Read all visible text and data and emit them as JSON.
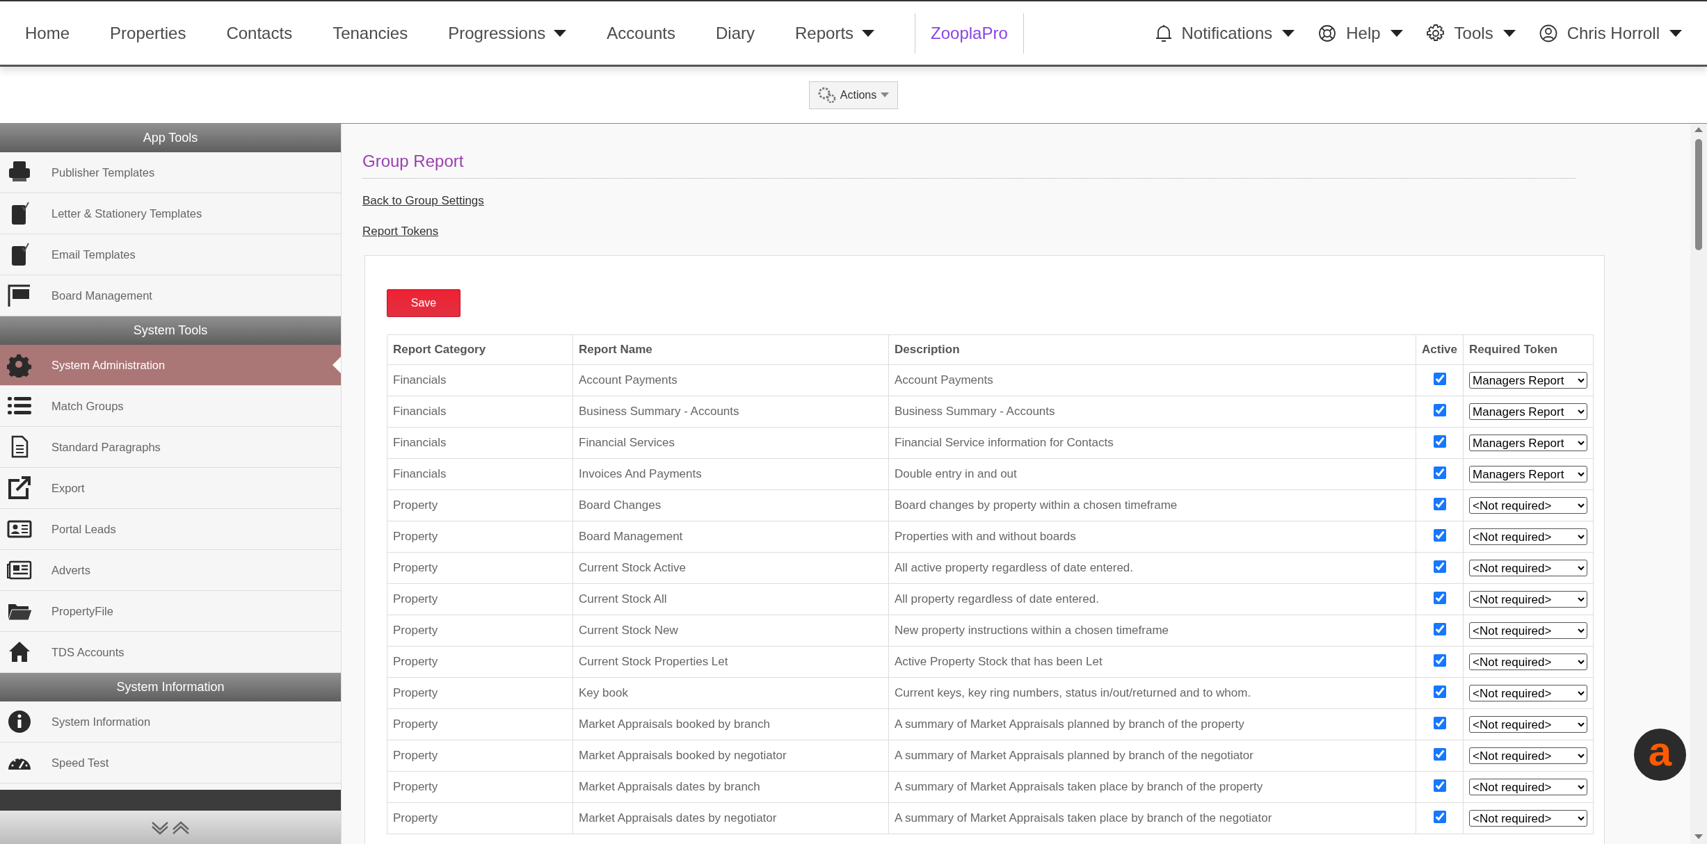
{
  "nav": {
    "items": [
      {
        "label": "Home",
        "dropdown": false,
        "kind": "link"
      },
      {
        "label": "Properties",
        "dropdown": false,
        "kind": "link"
      },
      {
        "label": "Contacts",
        "dropdown": false,
        "kind": "link"
      },
      {
        "label": "Tenancies",
        "dropdown": false,
        "kind": "link"
      },
      {
        "label": "Progressions",
        "dropdown": true,
        "kind": "link"
      },
      {
        "label": "Accounts",
        "dropdown": false,
        "kind": "link"
      },
      {
        "label": "Diary",
        "dropdown": false,
        "kind": "link"
      },
      {
        "label": "Reports",
        "dropdown": true,
        "kind": "link"
      },
      {
        "label": "ZooplaPro",
        "dropdown": false,
        "kind": "brand"
      }
    ],
    "right": [
      {
        "label": "Notifications",
        "dropdown": true
      },
      {
        "label": "Help",
        "dropdown": true
      },
      {
        "label": "Tools",
        "dropdown": true
      },
      {
        "label": "Chris Horroll",
        "dropdown": true
      }
    ]
  },
  "actions_button": "Actions",
  "sidebar": {
    "sections": [
      {
        "title": "App Tools",
        "items": [
          {
            "label": "Publisher Templates",
            "selected": false
          },
          {
            "label": "Letter & Stationery Templates",
            "selected": false
          },
          {
            "label": "Email Templates",
            "selected": false
          },
          {
            "label": "Board Management",
            "selected": false
          }
        ]
      },
      {
        "title": "System Tools",
        "items": [
          {
            "label": "System Administration",
            "selected": true
          },
          {
            "label": "Match Groups",
            "selected": false
          },
          {
            "label": "Standard Paragraphs",
            "selected": false
          },
          {
            "label": "Export",
            "selected": false
          },
          {
            "label": "Portal Leads",
            "selected": false
          },
          {
            "label": "Adverts",
            "selected": false
          },
          {
            "label": "PropertyFile",
            "selected": false
          },
          {
            "label": "TDS Accounts",
            "selected": false
          }
        ]
      },
      {
        "title": "System Information",
        "items": [
          {
            "label": "System Information",
            "selected": false
          },
          {
            "label": "Speed Test",
            "selected": false
          }
        ]
      }
    ]
  },
  "page": {
    "title": "Group Report",
    "links": [
      "Back to Group Settings",
      "Report Tokens"
    ],
    "save_button": "Save",
    "table": {
      "columns": [
        "Report Category",
        "Report Name",
        "Description",
        "Active",
        "Required Token"
      ],
      "rows": [
        {
          "category": "Financials",
          "name": "Account Payments",
          "description": "Account Payments",
          "active": true,
          "token": "Managers Report"
        },
        {
          "category": "Financials",
          "name": "Business Summary - Accounts",
          "description": "Business Summary - Accounts",
          "active": true,
          "token": "Managers Report"
        },
        {
          "category": "Financials",
          "name": "Financial Services",
          "description": "Financial Service information for Contacts",
          "active": true,
          "token": "Managers Report"
        },
        {
          "category": "Financials",
          "name": "Invoices And Payments",
          "description": "Double entry in and out",
          "active": true,
          "token": "Managers Report"
        },
        {
          "category": "Property",
          "name": "Board Changes",
          "description": "Board changes by property within a chosen timeframe",
          "active": true,
          "token": "<Not required>"
        },
        {
          "category": "Property",
          "name": "Board Management",
          "description": "Properties with and without boards",
          "active": true,
          "token": "<Not required>"
        },
        {
          "category": "Property",
          "name": "Current Stock Active",
          "description": "All active property regardless of date entered.",
          "active": true,
          "token": "<Not required>"
        },
        {
          "category": "Property",
          "name": "Current Stock All",
          "description": "All property regardless of date entered.",
          "active": true,
          "token": "<Not required>"
        },
        {
          "category": "Property",
          "name": "Current Stock New",
          "description": "New property instructions within a chosen timeframe",
          "active": true,
          "token": "<Not required>"
        },
        {
          "category": "Property",
          "name": "Current Stock Properties Let",
          "description": "Active Property Stock that has been Let",
          "active": true,
          "token": "<Not required>"
        },
        {
          "category": "Property",
          "name": "Key book",
          "description": "Current keys, key ring numbers, status in/out/returned and to whom.",
          "active": true,
          "token": "<Not required>"
        },
        {
          "category": "Property",
          "name": "Market Appraisals booked by branch",
          "description": "A summary of Market Appraisals planned by branch of the property",
          "active": true,
          "token": "<Not required>"
        },
        {
          "category": "Property",
          "name": "Market Appraisals booked by negotiator",
          "description": "A summary of Market Appraisals planned by branch of the negotiator",
          "active": true,
          "token": "<Not required>"
        },
        {
          "category": "Property",
          "name": "Market Appraisals dates by branch",
          "description": "A summary of Market Appraisals taken place by branch of the property",
          "active": true,
          "token": "<Not required>"
        },
        {
          "category": "Property",
          "name": "Market Appraisals dates by negotiator",
          "description": "A summary of Market Appraisals taken place by branch of the negotiator",
          "active": true,
          "token": "<Not required>"
        }
      ]
    }
  },
  "chat_button": "a"
}
